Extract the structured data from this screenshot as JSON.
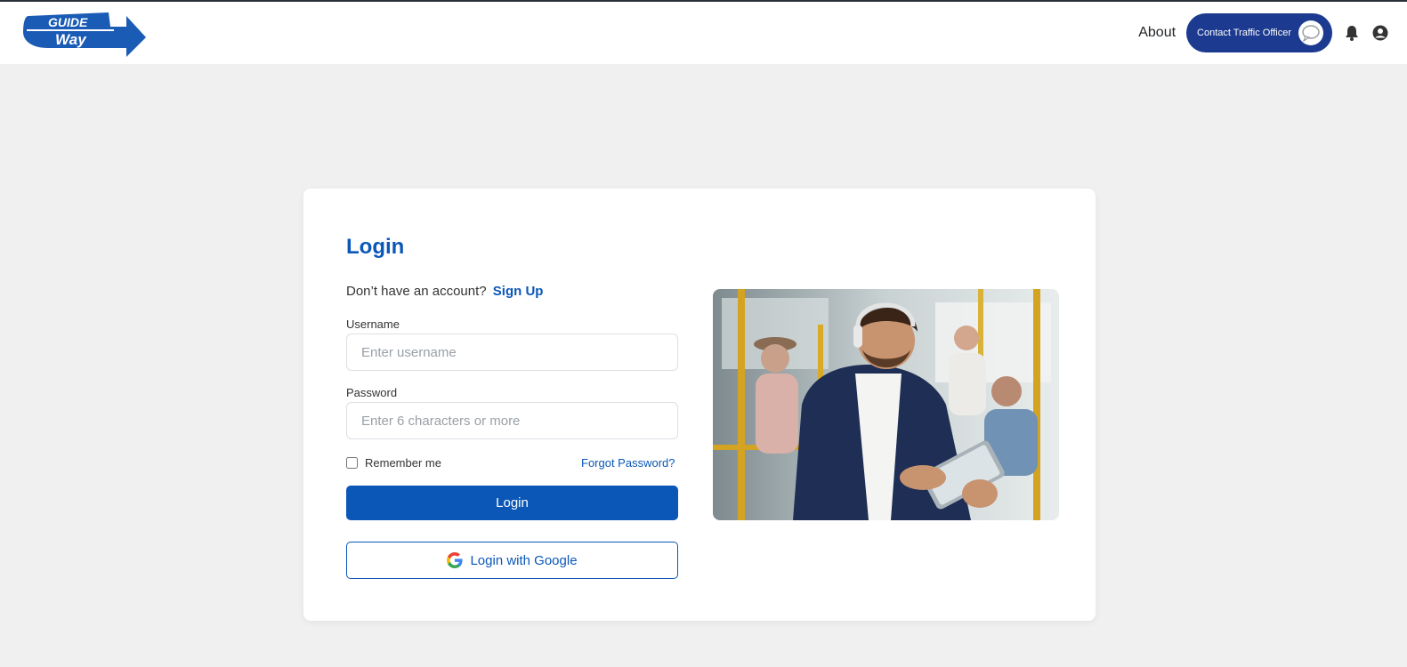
{
  "navbar": {
    "logo_text_top": "GUIDE",
    "logo_text_bottom": "Way",
    "about_label": "About",
    "contact_label": "Contact Traffic Officer",
    "icons": [
      "chat-bubble-icon",
      "bell-icon",
      "user-circle-icon"
    ]
  },
  "login": {
    "title": "Login",
    "no_account_text": "Don’t have an account?",
    "signup_label": "Sign Up",
    "username_label": "Username",
    "username_placeholder": "Enter username",
    "password_label": "Password",
    "password_placeholder": "Enter 6 characters or more",
    "remember_label": "Remember me",
    "forgot_label": "Forgot Password?",
    "login_button": "Login",
    "google_button": "Login with Google"
  },
  "colors": {
    "brand_blue": "#0b57b8",
    "nav_button": "#1c3a8f",
    "page_bg": "#f0f0f0"
  }
}
